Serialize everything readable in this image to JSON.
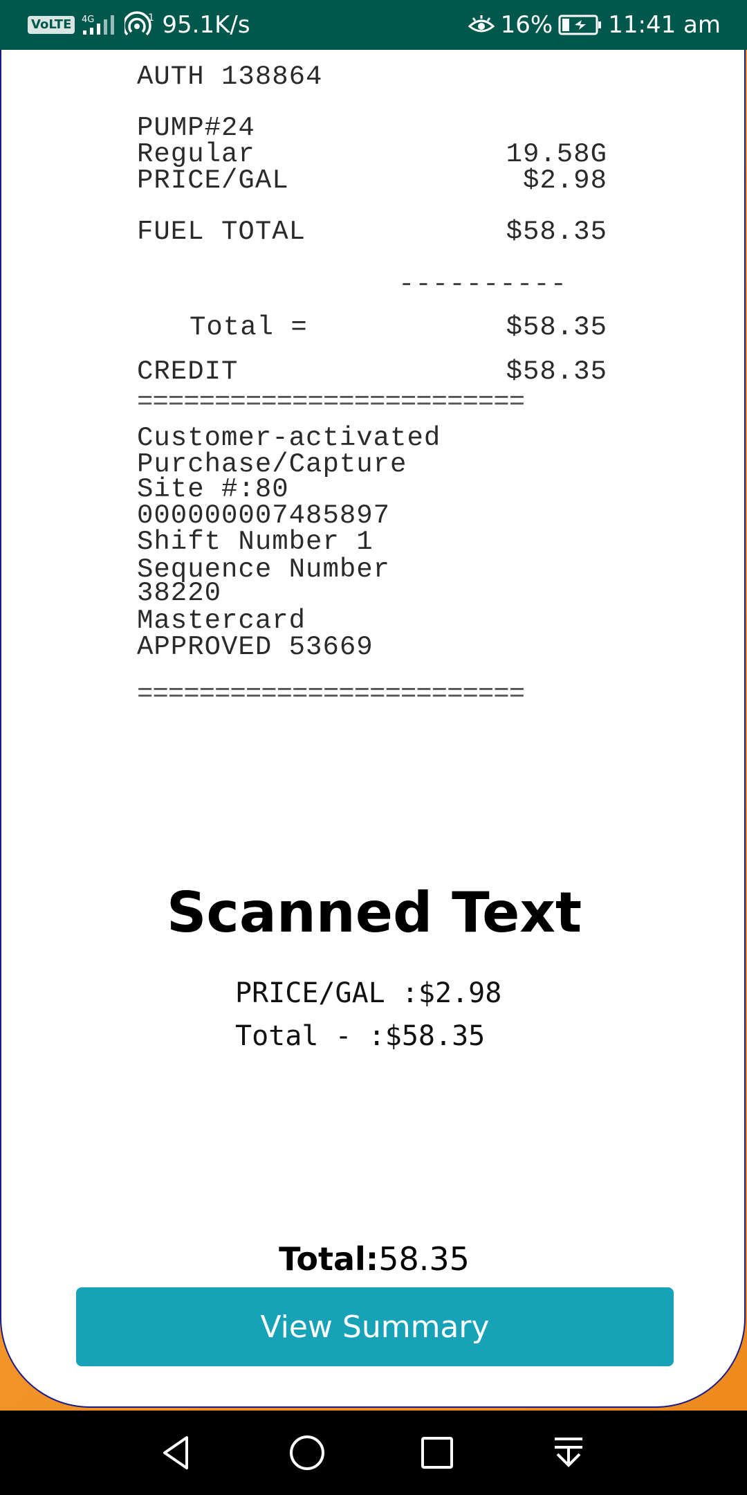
{
  "status_bar": {
    "volte_label": "VoLTE",
    "network_label": "4G",
    "hotspot_count": "1",
    "speed": "95.1K/s",
    "battery_percent": "16%",
    "time": "11:41 am",
    "icons": [
      "signal-icon",
      "hotspot-icon",
      "eye-icon",
      "battery-icon"
    ]
  },
  "receipt": {
    "auth": "AUTH 138864",
    "pump": "PUMP#24",
    "grade_label": "Regular",
    "grade_value": "19.58G",
    "price_label": "PRICE/GAL",
    "price_value": "$2.98",
    "fuel_total_label": "FUEL TOTAL",
    "fuel_total_value": "$58.35",
    "dash_rule": "----------",
    "total_label": "Total =",
    "total_value": "$58.35",
    "credit_label": "CREDIT",
    "credit_value": "$58.35",
    "eq_rule_1": "=========================",
    "line_1": "Customer-activated",
    "line_2": "Purchase/Capture",
    "line_3": "Site #:80",
    "line_4": "000000007485897",
    "line_5": "Shift Number 1",
    "line_6": "Sequence Number",
    "line_7": "38220",
    "line_8": "Mastercard",
    "line_9": "APPROVED 53669",
    "eq_rule_2": "========================="
  },
  "scanned": {
    "title": "Scanned Text",
    "lines": [
      "PRICE/GAL :$2.98",
      "Total - :$58.35"
    ]
  },
  "total": {
    "label": "Total:",
    "value": "58.35"
  },
  "actions": {
    "view_summary_label": "View Summary"
  },
  "nav_bar": {
    "icons": [
      "back-icon",
      "home-icon",
      "recents-icon",
      "notification-pull-icon"
    ]
  },
  "colors": {
    "status_bar": "#00574b",
    "button": "#17a2b8",
    "background_accent": "#f39a2c",
    "card_border": "#1a1a8c"
  }
}
